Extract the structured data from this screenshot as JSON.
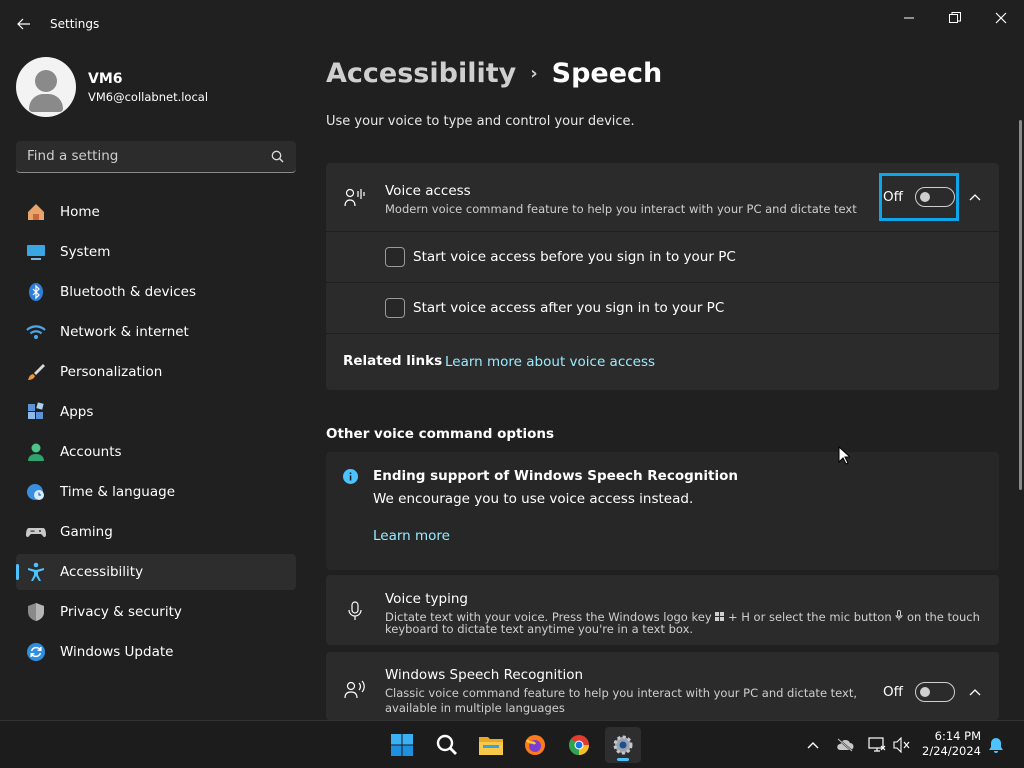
{
  "window": {
    "title": "Settings",
    "controls": [
      "minimize",
      "restore",
      "close"
    ]
  },
  "profile": {
    "name": "VM6",
    "email": "VM6@collabnet.local"
  },
  "search": {
    "placeholder": "Find a setting"
  },
  "sidebar": {
    "items": [
      {
        "label": "Home",
        "icon": "home-icon"
      },
      {
        "label": "System",
        "icon": "system-icon"
      },
      {
        "label": "Bluetooth & devices",
        "icon": "bluetooth-icon"
      },
      {
        "label": "Network & internet",
        "icon": "wifi-icon"
      },
      {
        "label": "Personalization",
        "icon": "brush-icon"
      },
      {
        "label": "Apps",
        "icon": "apps-icon"
      },
      {
        "label": "Accounts",
        "icon": "accounts-icon"
      },
      {
        "label": "Time & language",
        "icon": "clock-globe-icon"
      },
      {
        "label": "Gaming",
        "icon": "gamepad-icon"
      },
      {
        "label": "Accessibility",
        "icon": "accessibility-icon",
        "active": true
      },
      {
        "label": "Privacy & security",
        "icon": "shield-icon"
      },
      {
        "label": "Windows Update",
        "icon": "update-icon"
      }
    ]
  },
  "breadcrumb": {
    "parent": "Accessibility",
    "separator": "›",
    "current": "Speech"
  },
  "page": {
    "subtitle": "Use your voice to type and control your device."
  },
  "voice_access": {
    "title": "Voice access",
    "description": "Modern voice command feature to help you interact with your PC and dictate text",
    "toggle_state": "Off",
    "options": [
      "Start voice access before you sign in to your PC",
      "Start voice access after you sign in to your PC"
    ],
    "related_label": "Related links",
    "related_link": "Learn more about voice access"
  },
  "other_section": {
    "title": "Other voice command options"
  },
  "info_banner": {
    "title": "Ending support of Windows Speech Recognition",
    "body": "We encourage you to use voice access instead.",
    "link": "Learn more"
  },
  "voice_typing": {
    "title": "Voice typing",
    "description_1": "Dictate text with your voice. Press the Windows logo key",
    "description_2": "+ H or select the mic button",
    "description_3": "on the touch",
    "description_4": "keyboard to dictate text anytime you're in a text box."
  },
  "speech_recognition": {
    "title": "Windows Speech Recognition",
    "description_1": "Classic voice command feature to help you interact with your PC and dictate text,",
    "description_2": "available in multiple languages",
    "toggle_state": "Off"
  },
  "taskbar": {
    "apps": [
      "start-icon",
      "search-icon",
      "file-explorer-icon",
      "firefox-icon",
      "chrome-icon",
      "settings-icon"
    ],
    "time": "6:14 PM",
    "date": "2/24/2024"
  },
  "colors": {
    "accent": "#4cc2ff",
    "link": "#99ebff",
    "background": "#202020",
    "card": "#2b2b2b",
    "highlight_box": "#0ea5e9"
  }
}
